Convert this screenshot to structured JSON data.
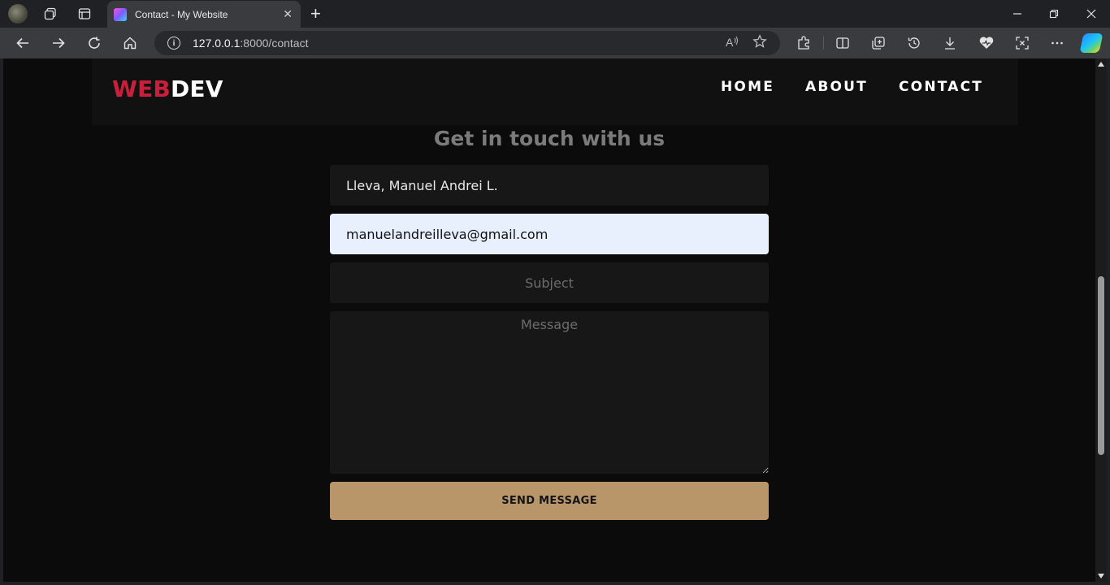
{
  "browser": {
    "tab_title": "Contact - My Website",
    "url_host": "127.0.0.1",
    "url_path": ":8000/contact",
    "new_tab_glyph": "+",
    "tab_close_glyph": "✕"
  },
  "site": {
    "logo_part1": "WEB",
    "logo_part2": "DEV",
    "nav": [
      "HOME",
      "ABOUT",
      "CONTACT"
    ]
  },
  "contact_form": {
    "heading": "Get in touch with us",
    "name_value": "Lleva, Manuel Andrei L.",
    "email_value": "manuelandreilleva@gmail.com",
    "subject_placeholder": "Subject",
    "message_placeholder": "Message",
    "submit_label": "SEND MESSAGE"
  },
  "colors": {
    "logo_red": "#c8203a",
    "button_tan": "#b8966a",
    "page_bg": "#0c0b0c"
  }
}
